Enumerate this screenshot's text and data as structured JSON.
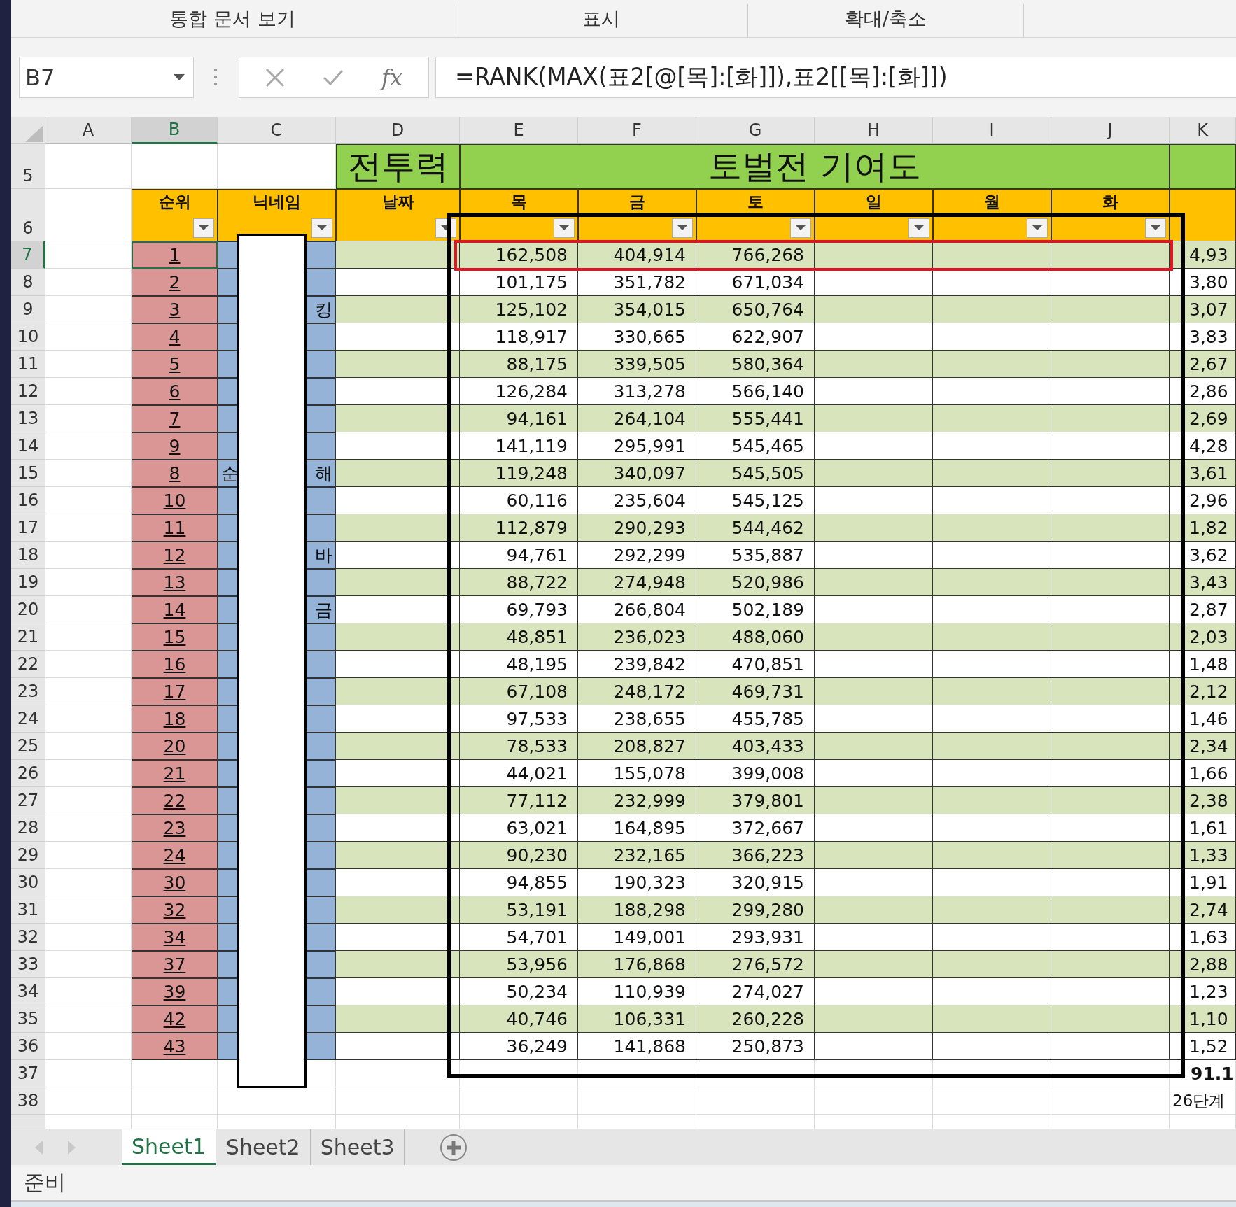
{
  "ribbon_groups": [
    "통합 문서 보기",
    "표시",
    "확대/축소"
  ],
  "name_box": "B7",
  "function_label": "fx",
  "formula": "=RANK(MAX(표2[@[목]:[화]]),표2[[목]:[화]])",
  "columns": [
    {
      "label": "A",
      "selected": false
    },
    {
      "label": "B",
      "selected": true
    },
    {
      "label": "C",
      "selected": false
    },
    {
      "label": "D",
      "selected": false
    },
    {
      "label": "E",
      "selected": false
    },
    {
      "label": "F",
      "selected": false
    },
    {
      "label": "G",
      "selected": false
    },
    {
      "label": "H",
      "selected": false
    },
    {
      "label": "I",
      "selected": false
    },
    {
      "label": "J",
      "selected": false
    },
    {
      "label": "K",
      "selected": false
    }
  ],
  "title_row": {
    "row": "5",
    "power_title": "전투력",
    "contribution_title": "토벌전 기여도"
  },
  "header_row": {
    "row": "6",
    "rank": "순위",
    "nickname": "닉네임",
    "date": "날짜",
    "days": [
      "목",
      "금",
      "토",
      "일",
      "월",
      "화"
    ]
  },
  "rows": [
    {
      "row": "7",
      "selected": true,
      "rank": "1",
      "values": [
        "162,508",
        "404,914",
        "766,268"
      ],
      "k": "4,93"
    },
    {
      "row": "8",
      "selected": false,
      "rank": "2",
      "values": [
        "101,175",
        "351,782",
        "671,034"
      ],
      "k": "3,80"
    },
    {
      "row": "9",
      "selected": false,
      "rank": "3",
      "nick_right": "킹",
      "values": [
        "125,102",
        "354,015",
        "650,764"
      ],
      "k": "3,07"
    },
    {
      "row": "10",
      "selected": false,
      "rank": "4",
      "values": [
        "118,917",
        "330,665",
        "622,907"
      ],
      "k": "3,83"
    },
    {
      "row": "11",
      "selected": false,
      "rank": "5",
      "values": [
        "88,175",
        "339,505",
        "580,364"
      ],
      "k": "2,67"
    },
    {
      "row": "12",
      "selected": false,
      "rank": "6",
      "values": [
        "126,284",
        "313,278",
        "566,140"
      ],
      "k": "2,86"
    },
    {
      "row": "13",
      "selected": false,
      "rank": "7",
      "values": [
        "94,161",
        "264,104",
        "555,441"
      ],
      "k": "2,69"
    },
    {
      "row": "14",
      "selected": false,
      "rank": "9",
      "values": [
        "141,119",
        "295,991",
        "545,465"
      ],
      "k": "4,28"
    },
    {
      "row": "15",
      "selected": false,
      "rank": "8",
      "nick_left": "순",
      "nick_right": "해",
      "values": [
        "119,248",
        "340,097",
        "545,505"
      ],
      "k": "3,61"
    },
    {
      "row": "16",
      "selected": false,
      "rank": "10",
      "values": [
        "60,116",
        "235,604",
        "545,125"
      ],
      "k": "2,96"
    },
    {
      "row": "17",
      "selected": false,
      "rank": "11",
      "values": [
        "112,879",
        "290,293",
        "544,462"
      ],
      "k": "1,82"
    },
    {
      "row": "18",
      "selected": false,
      "rank": "12",
      "nick_right": "바",
      "values": [
        "94,761",
        "292,299",
        "535,887"
      ],
      "k": "3,62"
    },
    {
      "row": "19",
      "selected": false,
      "rank": "13",
      "values": [
        "88,722",
        "274,948",
        "520,986"
      ],
      "k": "3,43"
    },
    {
      "row": "20",
      "selected": false,
      "rank": "14",
      "nick_right": "금",
      "values": [
        "69,793",
        "266,804",
        "502,189"
      ],
      "k": "2,87"
    },
    {
      "row": "21",
      "selected": false,
      "rank": "15",
      "values": [
        "48,851",
        "236,023",
        "488,060"
      ],
      "k": "2,03"
    },
    {
      "row": "22",
      "selected": false,
      "rank": "16",
      "values": [
        "48,195",
        "239,842",
        "470,851"
      ],
      "k": "1,48"
    },
    {
      "row": "23",
      "selected": false,
      "rank": "17",
      "values": [
        "67,108",
        "248,172",
        "469,731"
      ],
      "k": "2,12"
    },
    {
      "row": "24",
      "selected": false,
      "rank": "18",
      "values": [
        "97,533",
        "238,655",
        "455,785"
      ],
      "k": "1,46"
    },
    {
      "row": "25",
      "selected": false,
      "rank": "20",
      "values": [
        "78,533",
        "208,827",
        "403,433"
      ],
      "k": "2,34"
    },
    {
      "row": "26",
      "selected": false,
      "rank": "21",
      "values": [
        "44,021",
        "155,078",
        "399,008"
      ],
      "k": "1,66"
    },
    {
      "row": "27",
      "selected": false,
      "rank": "22",
      "values": [
        "77,112",
        "232,999",
        "379,801"
      ],
      "k": "2,38"
    },
    {
      "row": "28",
      "selected": false,
      "rank": "23",
      "values": [
        "63,021",
        "164,895",
        "372,667"
      ],
      "k": "1,61"
    },
    {
      "row": "29",
      "selected": false,
      "rank": "24",
      "values": [
        "90,230",
        "232,165",
        "366,223"
      ],
      "k": "1,33"
    },
    {
      "row": "30",
      "selected": false,
      "rank": "30",
      "values": [
        "94,855",
        "190,323",
        "320,915"
      ],
      "k": "1,91"
    },
    {
      "row": "31",
      "selected": false,
      "rank": "32",
      "values": [
        "53,191",
        "188,298",
        "299,280"
      ],
      "k": "2,74"
    },
    {
      "row": "32",
      "selected": false,
      "rank": "34",
      "values": [
        "54,701",
        "149,001",
        "293,931"
      ],
      "k": "1,63"
    },
    {
      "row": "33",
      "selected": false,
      "rank": "37",
      "values": [
        "53,956",
        "176,868",
        "276,572"
      ],
      "k": "2,88"
    },
    {
      "row": "34",
      "selected": false,
      "rank": "39",
      "values": [
        "50,234",
        "110,939",
        "274,027"
      ],
      "k": "1,23"
    },
    {
      "row": "35",
      "selected": false,
      "rank": "42",
      "values": [
        "40,746",
        "106,331",
        "260,228"
      ],
      "k": "1,10"
    },
    {
      "row": "36",
      "selected": false,
      "rank": "43",
      "values": [
        "36,249",
        "141,868",
        "250,873"
      ],
      "k": "1,52"
    }
  ],
  "footer_rows": [
    {
      "row": "37",
      "k": "91.1",
      "bold": true
    },
    {
      "row": "38",
      "k": "26단계",
      "bold": false
    }
  ],
  "sheet_tabs": [
    {
      "label": "Sheet1",
      "selected": true
    },
    {
      "label": "Sheet2",
      "selected": false
    },
    {
      "label": "Sheet3",
      "selected": false
    }
  ],
  "status": "준비"
}
